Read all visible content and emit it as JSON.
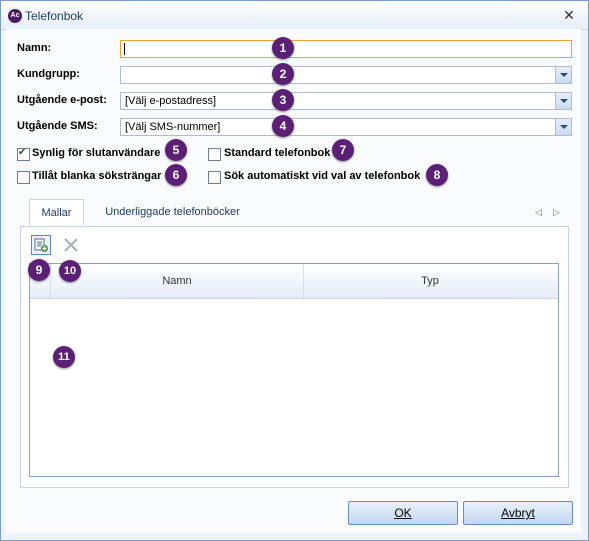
{
  "window": {
    "title": "Telefonbok",
    "app_icon_text": "Ac",
    "close_glyph": "✕"
  },
  "form": {
    "name_label": "Namn:",
    "name_value": "",
    "customer_group_label": "Kundgrupp:",
    "customer_group_value": "",
    "outgoing_email_label": "Utgående e-post:",
    "outgoing_email_value": "[Välj e-postadress]",
    "outgoing_sms_label": "Utgående SMS:",
    "outgoing_sms_value": "[Välj SMS-nummer]"
  },
  "checkboxes": {
    "visible_for_end_user": {
      "label": "Synlig för slutanvändare",
      "checked": true
    },
    "standard_phonebook": {
      "label": "Standard telefonbok",
      "checked": false
    },
    "allow_empty_search": {
      "label": "Tillåt blanka söksträngar",
      "checked": false
    },
    "auto_search": {
      "label": "Sök automatiskt vid val av telefonbok",
      "checked": false
    }
  },
  "tabs": [
    {
      "label": "Mallar",
      "active": true
    },
    {
      "label": "Underliggade telefonböcker",
      "active": false
    }
  ],
  "tab_nav": {
    "prev": "◁",
    "next": "▷"
  },
  "grid": {
    "columns": [
      "Namn",
      "Typ"
    ],
    "rows": []
  },
  "buttons": {
    "ok_label": "OK",
    "cancel_label": "Avbryt"
  },
  "badges": [
    "1",
    "2",
    "3",
    "4",
    "5",
    "6",
    "7",
    "8",
    "9",
    "10",
    "11"
  ],
  "colors": {
    "badge": "#5b2075",
    "focus_border": "#e8a23a",
    "window_border": "#7a9cc8"
  }
}
